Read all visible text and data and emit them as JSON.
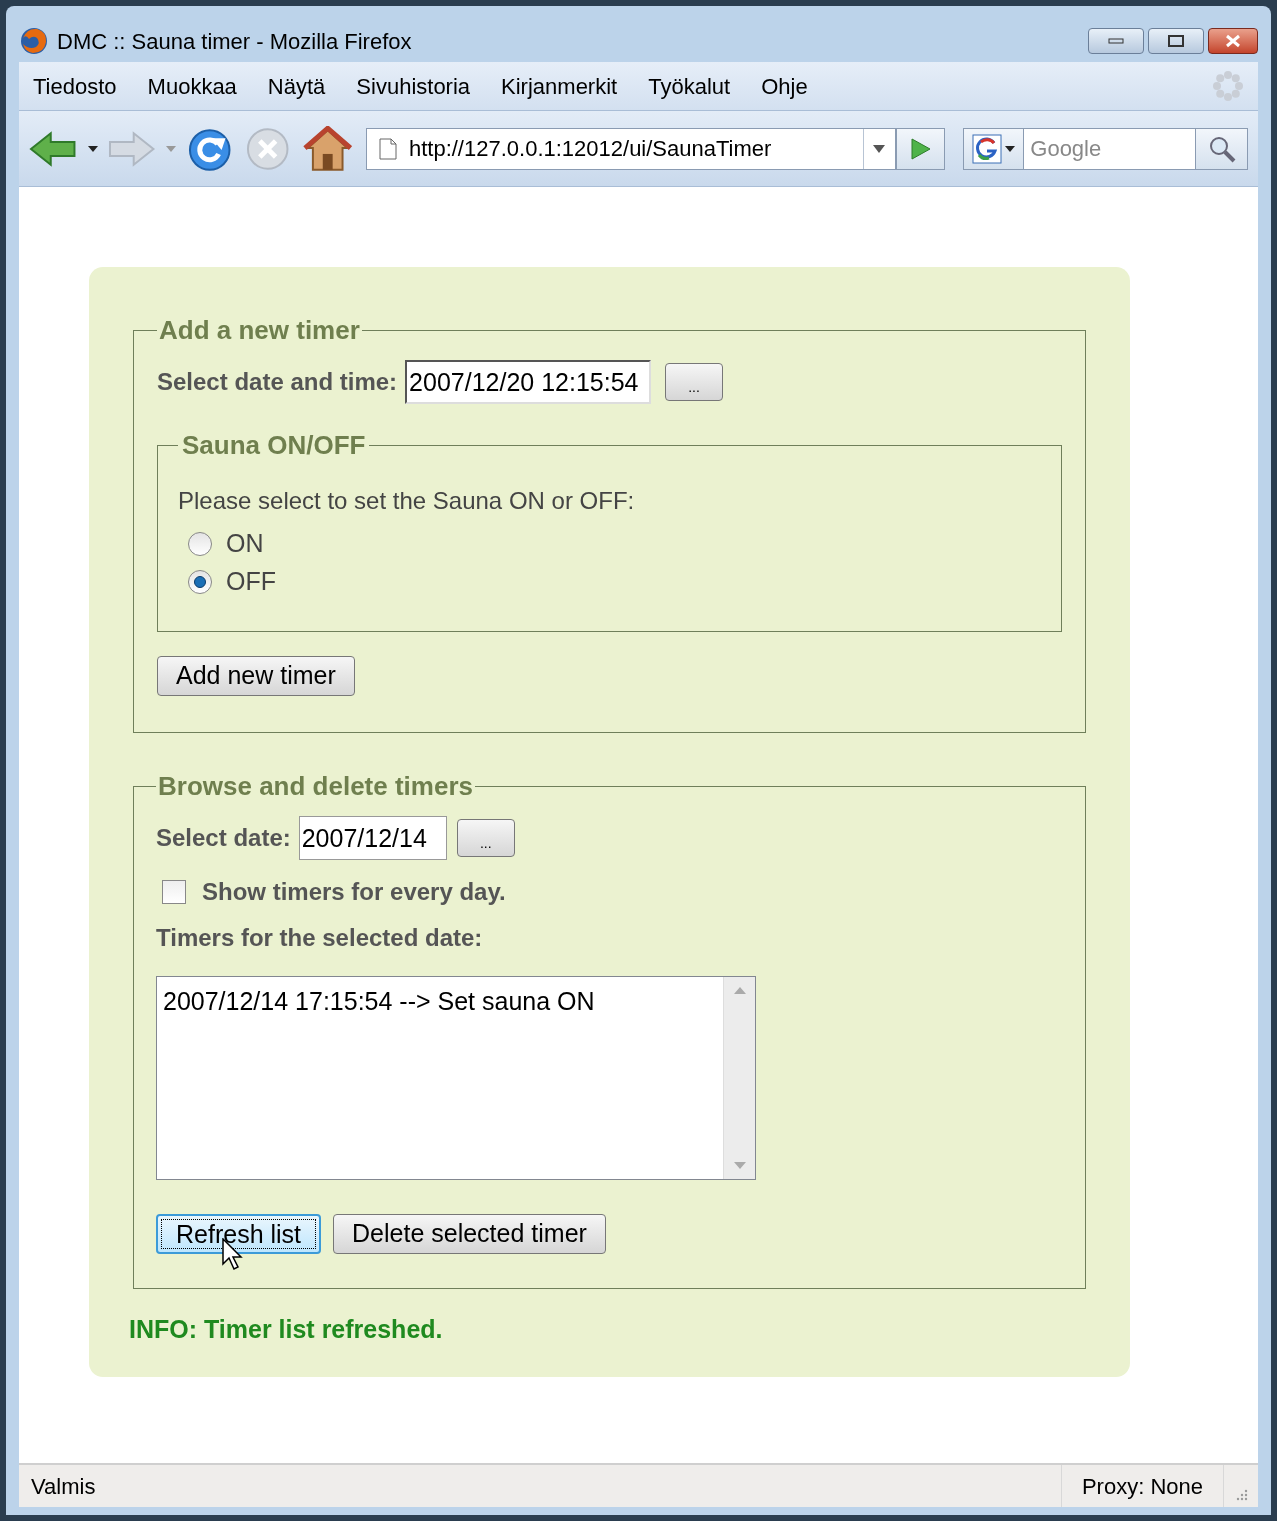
{
  "window": {
    "title": "DMC :: Sauna timer - Mozilla Firefox"
  },
  "menu": [
    "Tiedosto",
    "Muokkaa",
    "Näytä",
    "Sivuhistoria",
    "Kirjanmerkit",
    "Työkalut",
    "Ohje"
  ],
  "toolbar": {
    "url": "http://127.0.0.1:12012/ui/SaunaTimer",
    "search_placeholder": "Google"
  },
  "add_timer": {
    "legend": "Add a new timer",
    "date_label": "Select date and time:",
    "date_value": "2007/12/20 12:15:54",
    "picker_button": "...",
    "sauna": {
      "legend": "Sauna ON/OFF",
      "prompt": "Please select to set the Sauna ON or OFF:",
      "options": [
        {
          "label": "ON",
          "selected": false
        },
        {
          "label": "OFF",
          "selected": true
        }
      ]
    },
    "button": "Add new timer"
  },
  "browse": {
    "legend": "Browse and delete timers",
    "date_label": "Select date:",
    "date_value": "2007/12/14",
    "picker_button": "...",
    "every_day": {
      "label": "Show timers for every day.",
      "checked": false
    },
    "list_label": "Timers for the selected date:",
    "timers": [
      "2007/12/14 17:15:54 --> Set sauna ON"
    ],
    "buttons": [
      {
        "label": "Refresh list",
        "focused": true
      },
      {
        "label": "Delete selected timer",
        "focused": false
      }
    ]
  },
  "info": "INFO: Timer list refreshed.",
  "status_bar": {
    "status": "Valmis",
    "proxy": "Proxy: None"
  }
}
